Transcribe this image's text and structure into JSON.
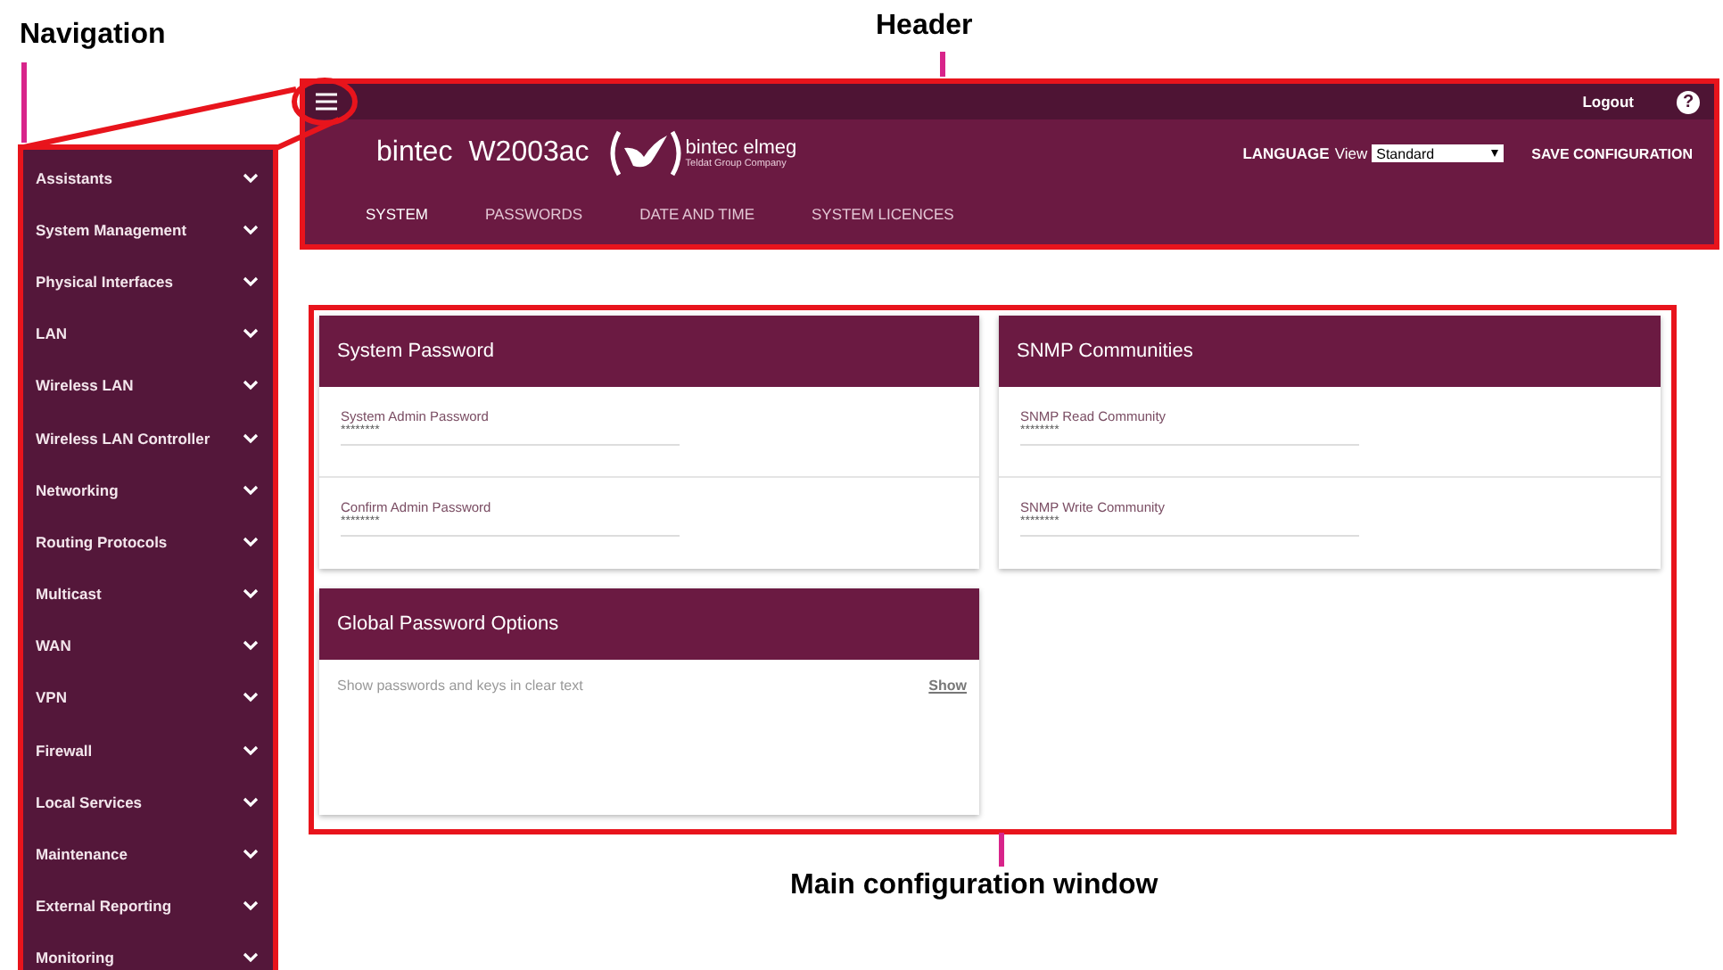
{
  "annotations": [
    {
      "kind": "navigation",
      "text": "Navigation"
    },
    {
      "kind": "header",
      "text": "Header"
    },
    {
      "kind": "main",
      "text": "Main configuration window"
    }
  ],
  "header": {
    "logout": "Logout",
    "help": "?",
    "product_brand": "bintec",
    "product_model": "W2003ac",
    "logo_name": "bintec elmeg",
    "logo_tagline": "Teldat Group Company",
    "language": "LANGUAGE",
    "view_label": "View",
    "view_value": "Standard",
    "save": "SAVE CONFIGURATION",
    "tabs": [
      {
        "label": "SYSTEM",
        "selected": true
      },
      {
        "label": "PASSWORDS",
        "selected": false
      },
      {
        "label": "DATE AND TIME",
        "selected": false
      },
      {
        "label": "SYSTEM LICENCES",
        "selected": false
      }
    ]
  },
  "navigation": {
    "items": [
      {
        "label": "Assistants"
      },
      {
        "label": "System Management"
      },
      {
        "label": "Physical Interfaces"
      },
      {
        "label": "LAN"
      },
      {
        "label": "Wireless LAN"
      },
      {
        "label": "Wireless LAN Controller"
      },
      {
        "label": "Networking"
      },
      {
        "label": "Routing Protocols"
      },
      {
        "label": "Multicast"
      },
      {
        "label": "WAN"
      },
      {
        "label": "VPN"
      },
      {
        "label": "Firewall"
      },
      {
        "label": "Local Services"
      },
      {
        "label": "Maintenance"
      },
      {
        "label": "External Reporting"
      },
      {
        "label": "Monitoring"
      }
    ]
  },
  "cards": [
    {
      "title": "System Password",
      "fields": [
        {
          "label": "System Admin Password",
          "value": "********"
        },
        {
          "label": "Confirm Admin Password",
          "value": "********"
        }
      ]
    },
    {
      "title": "SNMP Communities",
      "fields": [
        {
          "label": "SNMP Read Community",
          "value": "********"
        },
        {
          "label": "SNMP Write Community",
          "value": "********"
        }
      ]
    },
    {
      "title": "Global Password Options",
      "option": {
        "text": "Show passwords and keys in clear text",
        "link": "Show"
      }
    }
  ]
}
